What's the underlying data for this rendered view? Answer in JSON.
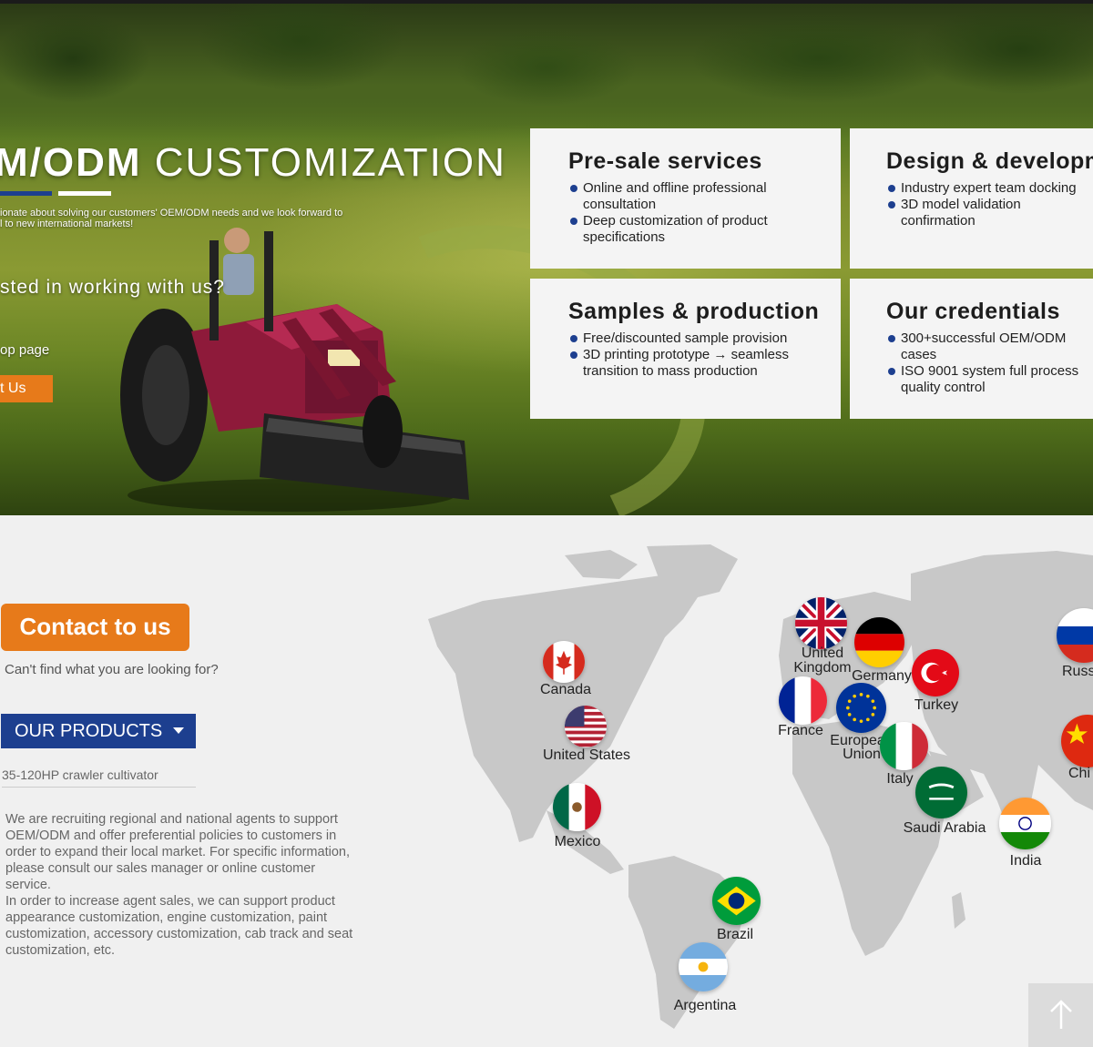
{
  "hero": {
    "title_bold": "M/ODM",
    "title_light": "CUSTOMIZATION",
    "description": "ionate about solving our customers' OEM/ODM needs and we look forward to\nl to new international markets!",
    "question": "sted in working with us?",
    "link": "op page",
    "button": "t Us"
  },
  "cards": [
    {
      "title": "Pre-sale services",
      "items": [
        "Online and offline professional consultation",
        "Deep customization of product specifications"
      ]
    },
    {
      "title": "Design & developm",
      "items": [
        "Industry expert team docking",
        "3D model validation confirmation"
      ]
    },
    {
      "title": "Samples & production",
      "items": [
        "Free/discounted sample provision",
        "3D printing prototype → seamless transition to mass production"
      ]
    },
    {
      "title": "Our credentials",
      "items": [
        "300+successful OEM/ODM cases",
        "ISO 9001 system full process quality control"
      ]
    }
  ],
  "contact": {
    "button": "Contact to us",
    "subtitle": "Can't find what you are looking for?"
  },
  "products": {
    "button": "OUR PRODUCTS",
    "item": "35-120HP crawler cultivator"
  },
  "agent_text": "We are recruiting regional and national agents to support OEM/ODM and offer preferential policies to customers in order to expand their local market. For specific information, please consult our sales manager or online customer service.\nIn order to increase agent sales, we can support product appearance customization, engine customization, paint customization, accessory customization, cab track and seat customization, etc.",
  "countries": {
    "canada": "Canada",
    "usa": "United States",
    "mexico": "Mexico",
    "brazil": "Brazil",
    "argentina": "Argentina",
    "uk": "United\nKingdom",
    "germany": "Germany",
    "turkey": "Turkey",
    "france": "France",
    "eu": "European\nUnion",
    "italy": "Italy",
    "saudi": "Saudi Arabia",
    "india": "India",
    "russia": "Russ",
    "china": "Chi"
  },
  "colors": {
    "accent_orange": "#e77a1a",
    "brand_blue": "#1d3f8f"
  }
}
